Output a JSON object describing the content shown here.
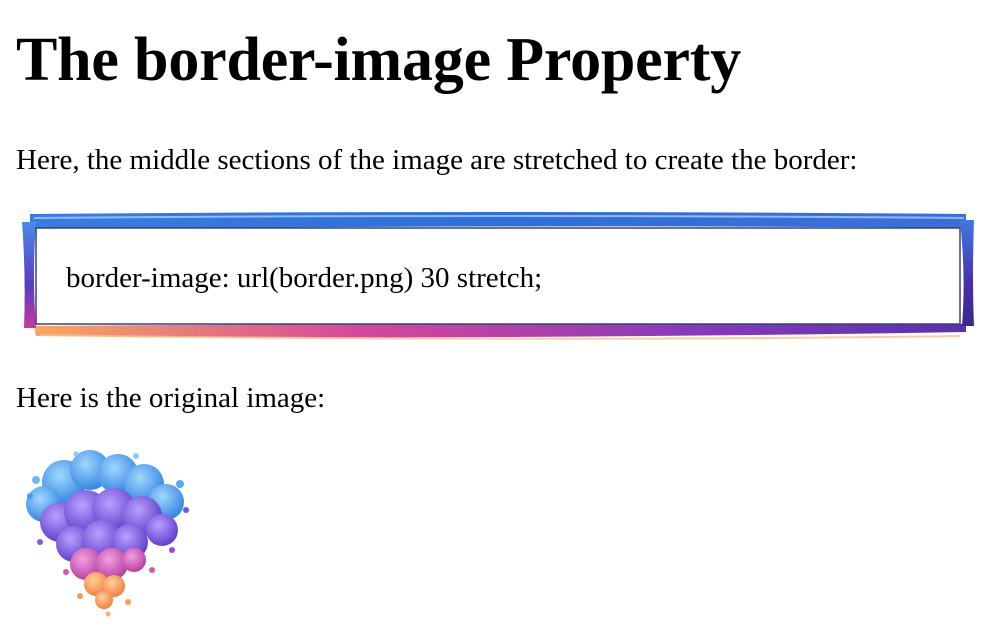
{
  "heading": "The border-image Property",
  "intro_text": "Here, the middle sections of the image are stretched to create the border:",
  "demo_text": "border-image: url(border.png) 30 stretch;",
  "caption_text": "Here is the original image:",
  "colors": {
    "text": "#000000",
    "background": "#ffffff",
    "border_blue": "#2f6fd6",
    "border_purple": "#6a2fbf",
    "border_magenta": "#c0309a",
    "border_orange": "#f39a4a"
  }
}
